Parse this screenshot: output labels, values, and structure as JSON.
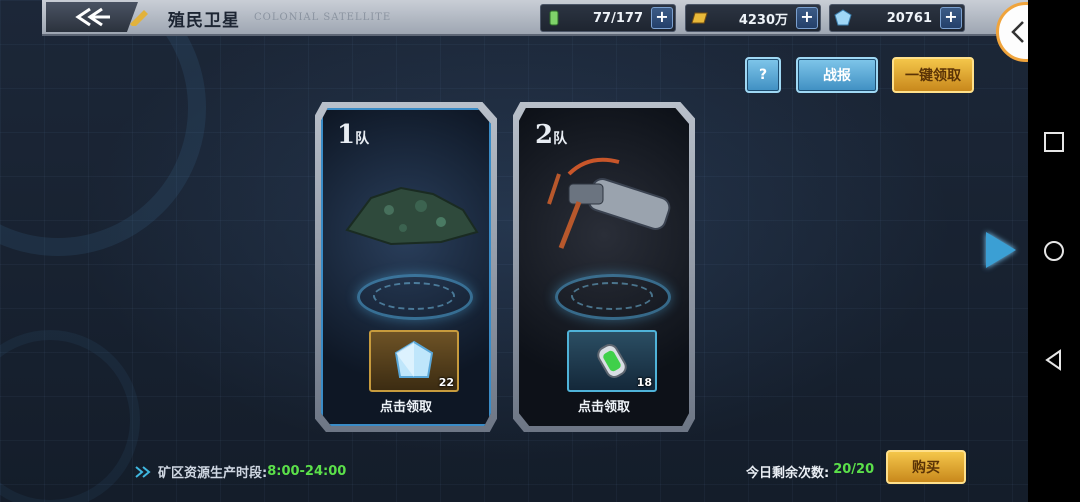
{
  "header": {
    "title_cn": "殖民卫星",
    "title_en": "COLONIAL SATELLITE"
  },
  "resources": [
    {
      "icon": "energy-battery-icon",
      "value": "77/177"
    },
    {
      "icon": "gold-bar-icon",
      "value": "4230万"
    },
    {
      "icon": "crystal-icon",
      "value": "20761"
    }
  ],
  "toolbar": {
    "help_label": "?",
    "battle_report_label": "战报",
    "claim_all_label": "一键领取"
  },
  "teams": [
    {
      "label_num": "1",
      "label_suffix": "队",
      "reward_count": "22",
      "claim_label": "点击领取"
    },
    {
      "label_num": "2",
      "label_suffix": "队",
      "reward_count": "18",
      "claim_label": "点击领取"
    }
  ],
  "footer": {
    "production_label": "矿区资源生产时段:",
    "production_time": "8:00-24:00",
    "remaining_label": "今日剩余次数:",
    "remaining_count": "20/20",
    "buy_label": "购买"
  },
  "colors": {
    "accent_blue": "#3f8fc2",
    "accent_gold": "#c8881c",
    "green_text": "#5be04a"
  }
}
